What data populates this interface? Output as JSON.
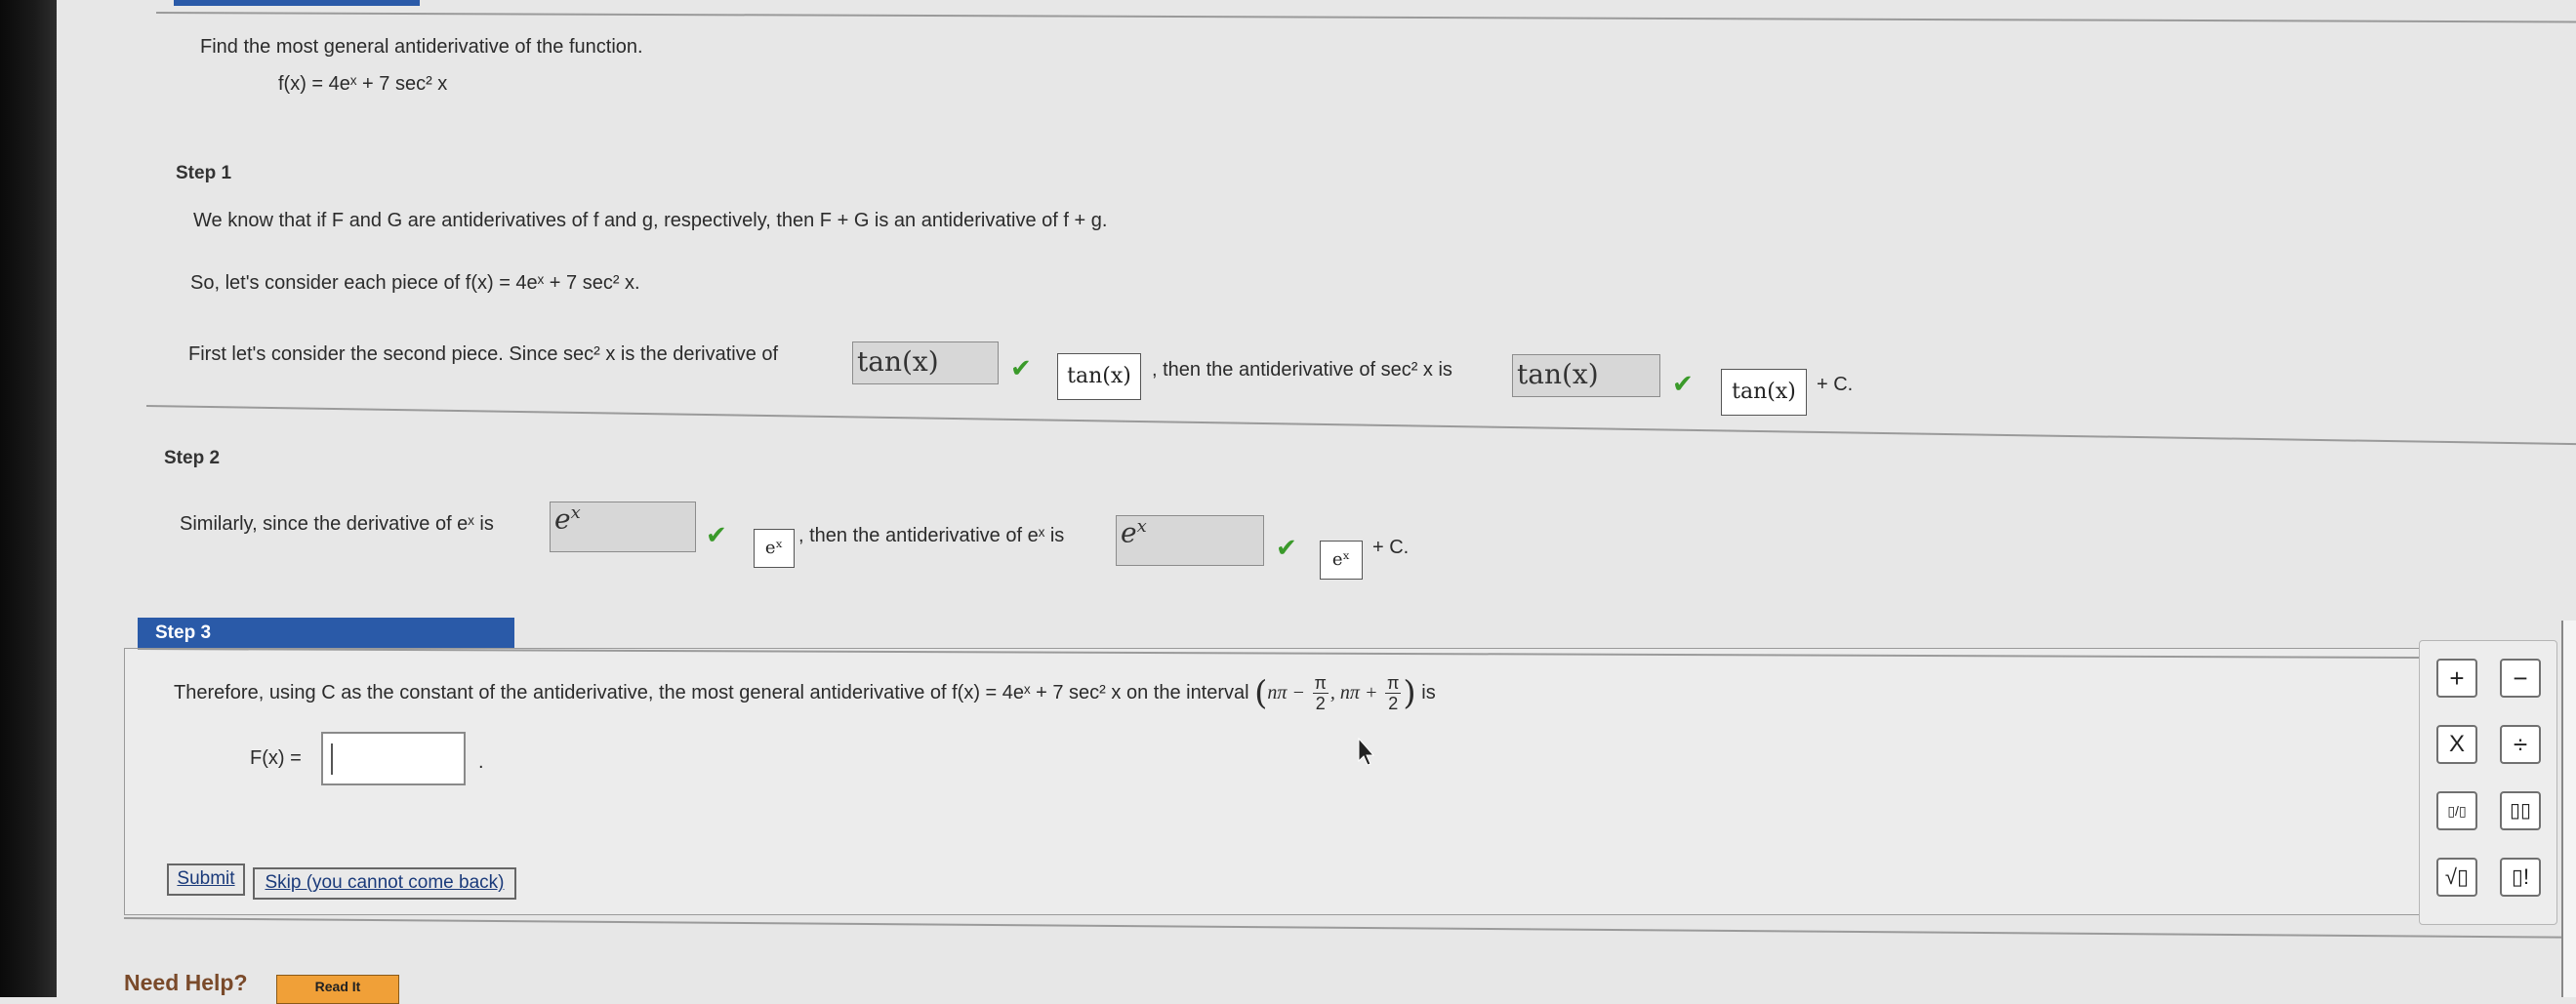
{
  "problem": {
    "prompt": "Find the most general antiderivative of the function.",
    "function": "f(x) = 4eˣ + 7 sec² x"
  },
  "step1": {
    "label": "Step 1",
    "line1": "We know that if F and G are antiderivatives of f and g, respectively, then  F + G  is an antiderivative of  f + g.",
    "line2": "So, let's consider each piece of  f(x) = 4eˣ + 7 sec² x.",
    "line3_pre": "First let's consider the second piece. Since  sec² x  is the derivative of",
    "line3_mid": ", then the antiderivative of  sec² x  is",
    "line3_post": "+ C.",
    "answer1": "tan(x)",
    "correct1": "tan(x)",
    "answer2": "tan(x)",
    "correct2": "tan(x)"
  },
  "step2": {
    "label": "Step 2",
    "line_pre": "Similarly, since the derivative of  eˣ  is",
    "line_mid": ", then the antiderivative of  eˣ is",
    "line_post": "+ C.",
    "answer1": "e",
    "answer1_sup": "x",
    "correct1": "eˣ",
    "answer2": "e",
    "answer2_sup": "x",
    "correct2": "eˣ"
  },
  "step3": {
    "label": "Step 3",
    "text_pre": "Therefore, using C as the constant of the antiderivative, the most general antiderivative of  f(x) = 4eˣ + 7 sec² x  on the interval",
    "interval_left": "nπ −",
    "interval_mid": ", nπ +",
    "pi": "π",
    "two": "2",
    "text_post": "is",
    "answer_label": "F(x) =",
    "answer_value": "",
    "period": "."
  },
  "buttons": {
    "submit": "Submit",
    "skip": "Skip (you cannot come back)"
  },
  "palette": {
    "plus": "+",
    "minus": "−",
    "times": "X",
    "divide": "÷",
    "fraction": "▯/▯",
    "power": "▯▯",
    "sqrt": "√▯",
    "factorial": "▯!"
  },
  "help": {
    "label": "Need Help?",
    "read_it": "Read It"
  },
  "colors": {
    "step3_tab": "#2a5aa8",
    "check": "#3a9a2a",
    "read_it": "#f0a038"
  }
}
